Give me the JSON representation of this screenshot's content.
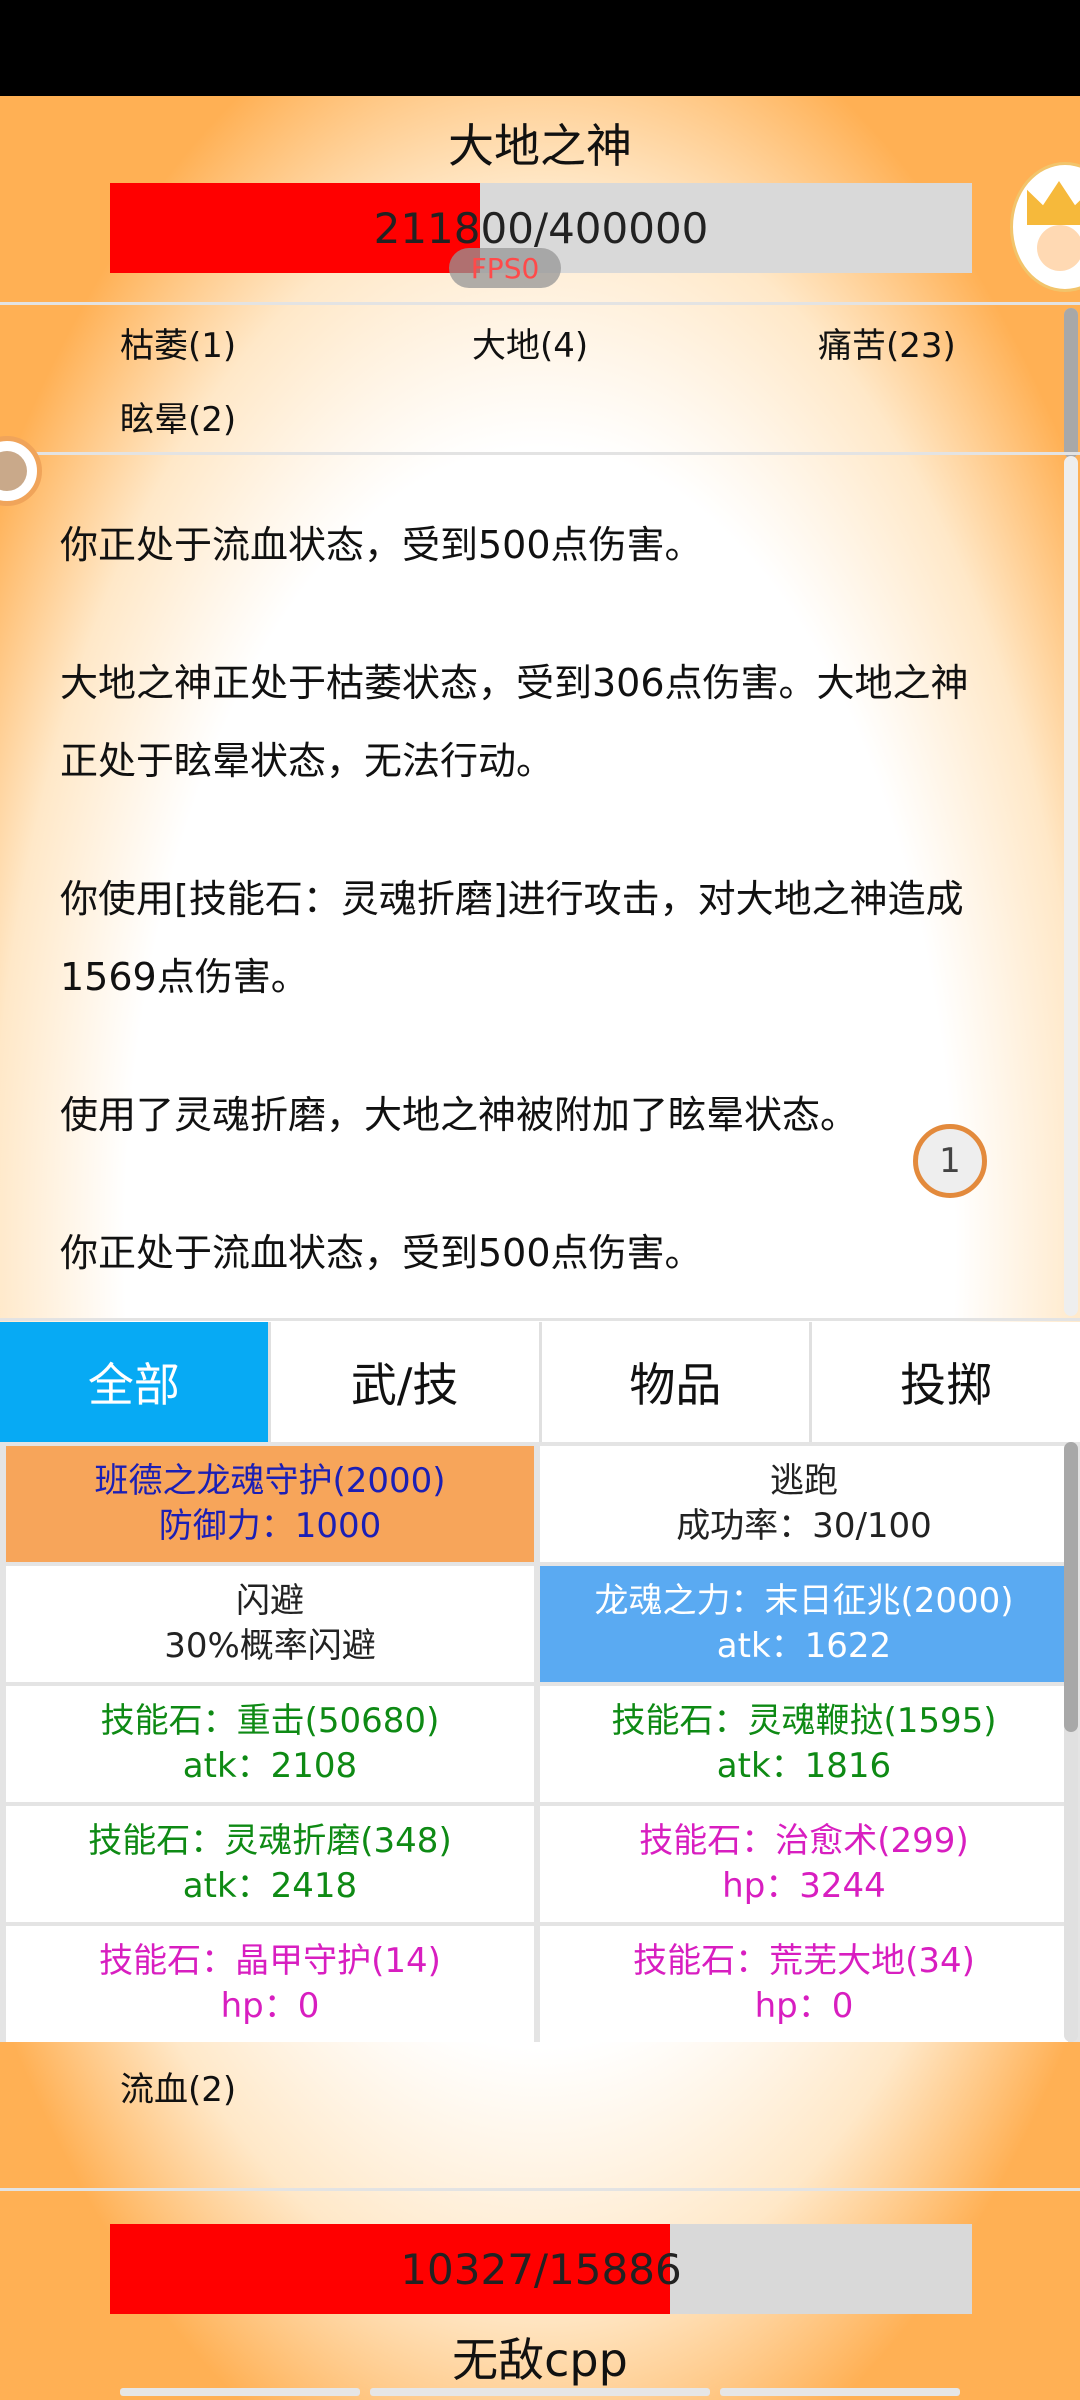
{
  "boss": {
    "name": "大地之神",
    "hp_text": "211800/400000",
    "hp_fraction": 0.4295
  },
  "fps_label": "FPS0",
  "boss_statuses": [
    "枯萎(1)",
    "大地(4)",
    "痛苦(23)",
    "眩晕(2)"
  ],
  "log": [
    "你正处于流血状态，受到500点伤害。",
    "大地之神正处于枯萎状态，受到306点伤害。大地之神正处于眩晕状态，无法行动。",
    "你使用[技能石：灵魂折磨]进行攻击，对大地之神造成1569点伤害。",
    "使用了灵魂折磨，大地之神被附加了眩晕状态。",
    "你正处于流血状态，受到500点伤害。"
  ],
  "counter_badge": "1",
  "tabs": [
    "全部",
    "武/技",
    "物品",
    "投掷"
  ],
  "active_tab": 0,
  "skills": [
    {
      "name": "班德之龙魂守护(2000)",
      "stat": "防御力：1000",
      "bg": "#f7a55a",
      "color": "#1b1fb5"
    },
    {
      "name": "逃跑",
      "stat": "成功率：30/100",
      "bg": "#ffffff",
      "color": "#222222"
    },
    {
      "name": "闪避",
      "stat": "30%概率闪避",
      "bg": "#ffffff",
      "color": "#222222"
    },
    {
      "name": "龙魂之力：末日征兆(2000)",
      "stat": "atk：1622",
      "bg": "#5aaaf2",
      "color": "#ffffff"
    },
    {
      "name": "技能石：重击(50680)",
      "stat": "atk：2108",
      "bg": "#ffffff",
      "color": "#0e8a14"
    },
    {
      "name": "技能石：灵魂鞭挞(1595)",
      "stat": "atk：1816",
      "bg": "#ffffff",
      "color": "#0e8a14"
    },
    {
      "name": "技能石：灵魂折磨(348)",
      "stat": "atk：2418",
      "bg": "#ffffff",
      "color": "#0e8a14"
    },
    {
      "name": "技能石：治愈术(299)",
      "stat": "hp：3244",
      "bg": "#ffffff",
      "color": "#d81ec0"
    },
    {
      "name": "技能石：晶甲守护(14)",
      "stat": "hp：0",
      "bg": "#ffffff",
      "color": "#d81ec0"
    },
    {
      "name": "技能石：荒芜大地(34)",
      "stat": "hp：0",
      "bg": "#ffffff",
      "color": "#d81ec0"
    }
  ],
  "player": {
    "status": "流血(2)",
    "hp_text": "10327/15886",
    "hp_fraction": 0.65,
    "name": "无敌cpp"
  }
}
